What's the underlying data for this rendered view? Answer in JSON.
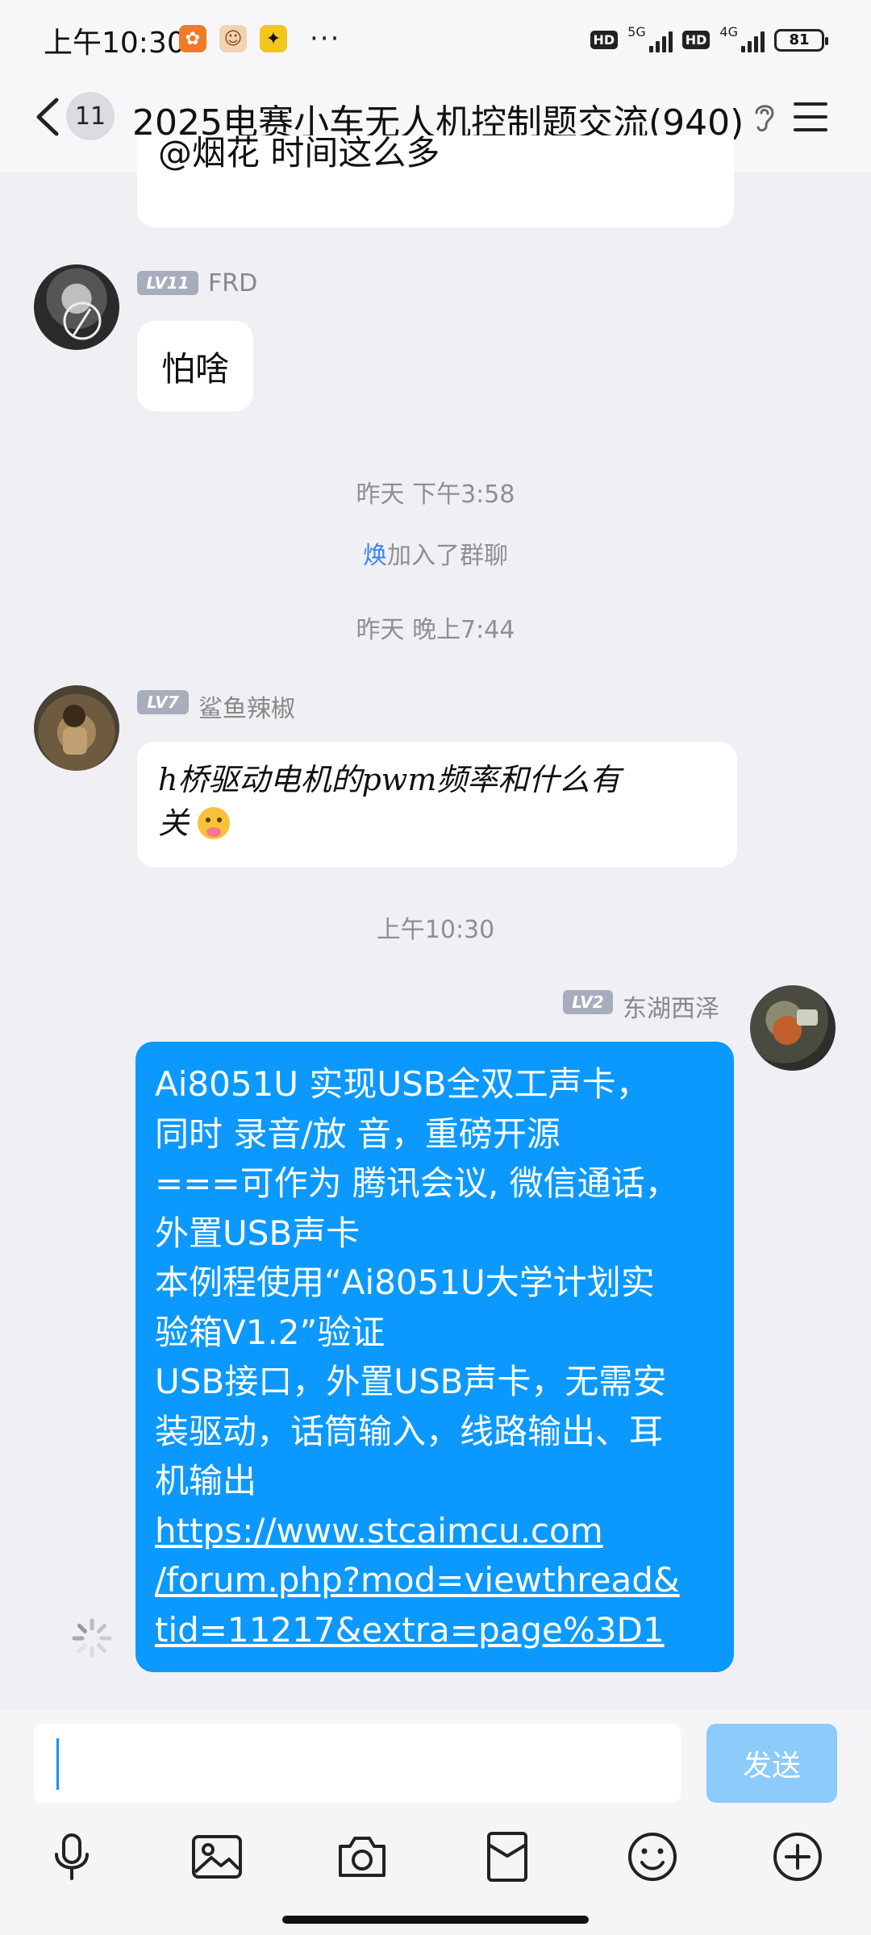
{
  "status_bar": {
    "time": "上午10:30",
    "apps": [
      "app-icon-1",
      "app-icon-2",
      "app-icon-3"
    ],
    "more": "···",
    "hd_label": "HD",
    "network_1": "5G",
    "network_2": "4G",
    "battery": "81"
  },
  "header": {
    "unread_count": "11",
    "title": "2025电赛小车无人机控制题交流(940)"
  },
  "messages": {
    "partial_message": "@烟花 时间这么多",
    "msg1": {
      "level": "LV11",
      "sender": "FRD",
      "text": "怕啥"
    },
    "sys1": {
      "time": "昨天 下午3:58"
    },
    "sys2": {
      "name": "焕",
      "text": "加入了群聊"
    },
    "sys3": {
      "time": "昨天 晚上7:44"
    },
    "msg2": {
      "level": "LV7",
      "sender": "鲨鱼辣椒",
      "line1": "h桥驱动电机的pwm频率和什么有",
      "line2": "关"
    },
    "sys4": {
      "time": "上午10:30"
    },
    "msg3": {
      "level": "LV2",
      "sender": "东湖西泽",
      "lines": [
        "Ai8051U 实现USB全双工声卡，",
        "同时 录音/放 音，重磅开源",
        "===可作为 腾讯会议, 微信通话，",
        "外置USB声卡",
        "本例程使用“Ai8051U大学计划实",
        "验箱V1.2”验证",
        "USB接口，外置USB声卡，无需安",
        "装驱动，话筒输入，线路输出、耳",
        "机输出"
      ],
      "link_lines": [
        "https://www.stcaimcu.com",
        "/forum.php?mod=viewthread&",
        "tid=11217&extra=page%3D1"
      ]
    }
  },
  "input": {
    "value": "",
    "send_label": "发送"
  },
  "colors": {
    "accent_blue": "#0b99ff",
    "send_disabled": "#8ccbfa",
    "background": "#efeff4"
  },
  "toolbar_icons": [
    "microphone-icon",
    "image-icon",
    "camera-icon",
    "red-packet-icon",
    "emoji-icon",
    "plus-icon"
  ]
}
